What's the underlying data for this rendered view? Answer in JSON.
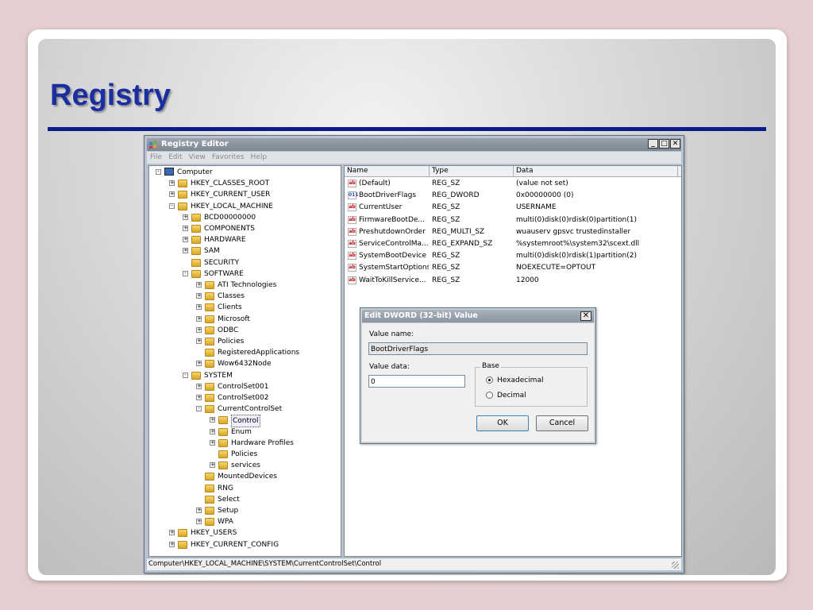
{
  "slide": {
    "title": "Registry"
  },
  "window": {
    "title": "Registry Editor",
    "minimize": "_",
    "maximize": "□",
    "close": "✕",
    "menu": [
      "File",
      "Edit",
      "View",
      "Favorites",
      "Help"
    ],
    "status": "Computer\\HKEY_LOCAL_MACHINE\\SYSTEM\\CurrentControlSet\\Control"
  },
  "tree": [
    {
      "label": "Computer",
      "level": 0,
      "exp": "-",
      "icon": "computer-icon"
    },
    {
      "label": "HKEY_CLASSES_ROOT",
      "level": 1,
      "exp": "+"
    },
    {
      "label": "HKEY_CURRENT_USER",
      "level": 1,
      "exp": "+"
    },
    {
      "label": "HKEY_LOCAL_MACHINE",
      "level": 1,
      "exp": "-"
    },
    {
      "label": "BCD00000000",
      "level": 2,
      "exp": "+"
    },
    {
      "label": "COMPONENTS",
      "level": 2,
      "exp": "+"
    },
    {
      "label": "HARDWARE",
      "level": 2,
      "exp": "+"
    },
    {
      "label": "SAM",
      "level": 2,
      "exp": "+"
    },
    {
      "label": "SECURITY",
      "level": 2,
      "exp": ""
    },
    {
      "label": "SOFTWARE",
      "level": 2,
      "exp": "-"
    },
    {
      "label": "ATI Technologies",
      "level": 3,
      "exp": "+"
    },
    {
      "label": "Classes",
      "level": 3,
      "exp": "+"
    },
    {
      "label": "Clients",
      "level": 3,
      "exp": "+"
    },
    {
      "label": "Microsoft",
      "level": 3,
      "exp": "+"
    },
    {
      "label": "ODBC",
      "level": 3,
      "exp": "+"
    },
    {
      "label": "Policies",
      "level": 3,
      "exp": "+"
    },
    {
      "label": "RegisteredApplications",
      "level": 3,
      "exp": ""
    },
    {
      "label": "Wow6432Node",
      "level": 3,
      "exp": "+"
    },
    {
      "label": "SYSTEM",
      "level": 2,
      "exp": "-"
    },
    {
      "label": "ControlSet001",
      "level": 3,
      "exp": "+"
    },
    {
      "label": "ControlSet002",
      "level": 3,
      "exp": "+"
    },
    {
      "label": "CurrentControlSet",
      "level": 3,
      "exp": "-"
    },
    {
      "label": "Control",
      "level": 4,
      "exp": "+",
      "selected": true
    },
    {
      "label": "Enum",
      "level": 4,
      "exp": "+"
    },
    {
      "label": "Hardware Profiles",
      "level": 4,
      "exp": "+"
    },
    {
      "label": "Policies",
      "level": 4,
      "exp": ""
    },
    {
      "label": "services",
      "level": 4,
      "exp": "+"
    },
    {
      "label": "MountedDevices",
      "level": 3,
      "exp": ""
    },
    {
      "label": "RNG",
      "level": 3,
      "exp": ""
    },
    {
      "label": "Select",
      "level": 3,
      "exp": ""
    },
    {
      "label": "Setup",
      "level": 3,
      "exp": "+"
    },
    {
      "label": "WPA",
      "level": 3,
      "exp": "+"
    },
    {
      "label": "HKEY_USERS",
      "level": 1,
      "exp": "+"
    },
    {
      "label": "HKEY_CURRENT_CONFIG",
      "level": 1,
      "exp": "+"
    }
  ],
  "list": {
    "columns": [
      "Name",
      "Type",
      "Data"
    ],
    "rows": [
      {
        "icon": "ab",
        "name": "(Default)",
        "type": "REG_SZ",
        "data": "(value not set)"
      },
      {
        "icon": "bin",
        "name": "BootDriverFlags",
        "type": "REG_DWORD",
        "data": "0x00000000 (0)"
      },
      {
        "icon": "ab",
        "name": "CurrentUser",
        "type": "REG_SZ",
        "data": "USERNAME"
      },
      {
        "icon": "ab",
        "name": "FirmwareBootDe...",
        "type": "REG_SZ",
        "data": "multi(0)disk(0)rdisk(0)partition(1)"
      },
      {
        "icon": "ab",
        "name": "PreshutdownOrder",
        "type": "REG_MULTI_SZ",
        "data": "wuauserv gpsvc trustedinstaller"
      },
      {
        "icon": "ab",
        "name": "ServiceControlMa...",
        "type": "REG_EXPAND_SZ",
        "data": "%systemroot%\\system32\\scext.dll"
      },
      {
        "icon": "ab",
        "name": "SystemBootDevice",
        "type": "REG_SZ",
        "data": "multi(0)disk(0)rdisk(1)partition(2)"
      },
      {
        "icon": "ab",
        "name": "SystemStartOptions",
        "type": "REG_SZ",
        "data": " NOEXECUTE=OPTOUT"
      },
      {
        "icon": "ab",
        "name": "WaitToKillService...",
        "type": "REG_SZ",
        "data": "12000"
      }
    ]
  },
  "dialog": {
    "title": "Edit DWORD (32-bit) Value",
    "close": "✕",
    "value_name_label": "Value name:",
    "value_name": "BootDriverFlags",
    "value_data_label": "Value data:",
    "value_data": "0",
    "base_label": "Base",
    "hex_label": "Hexadecimal",
    "dec_label": "Decimal",
    "ok_label": "OK",
    "cancel_label": "Cancel"
  }
}
